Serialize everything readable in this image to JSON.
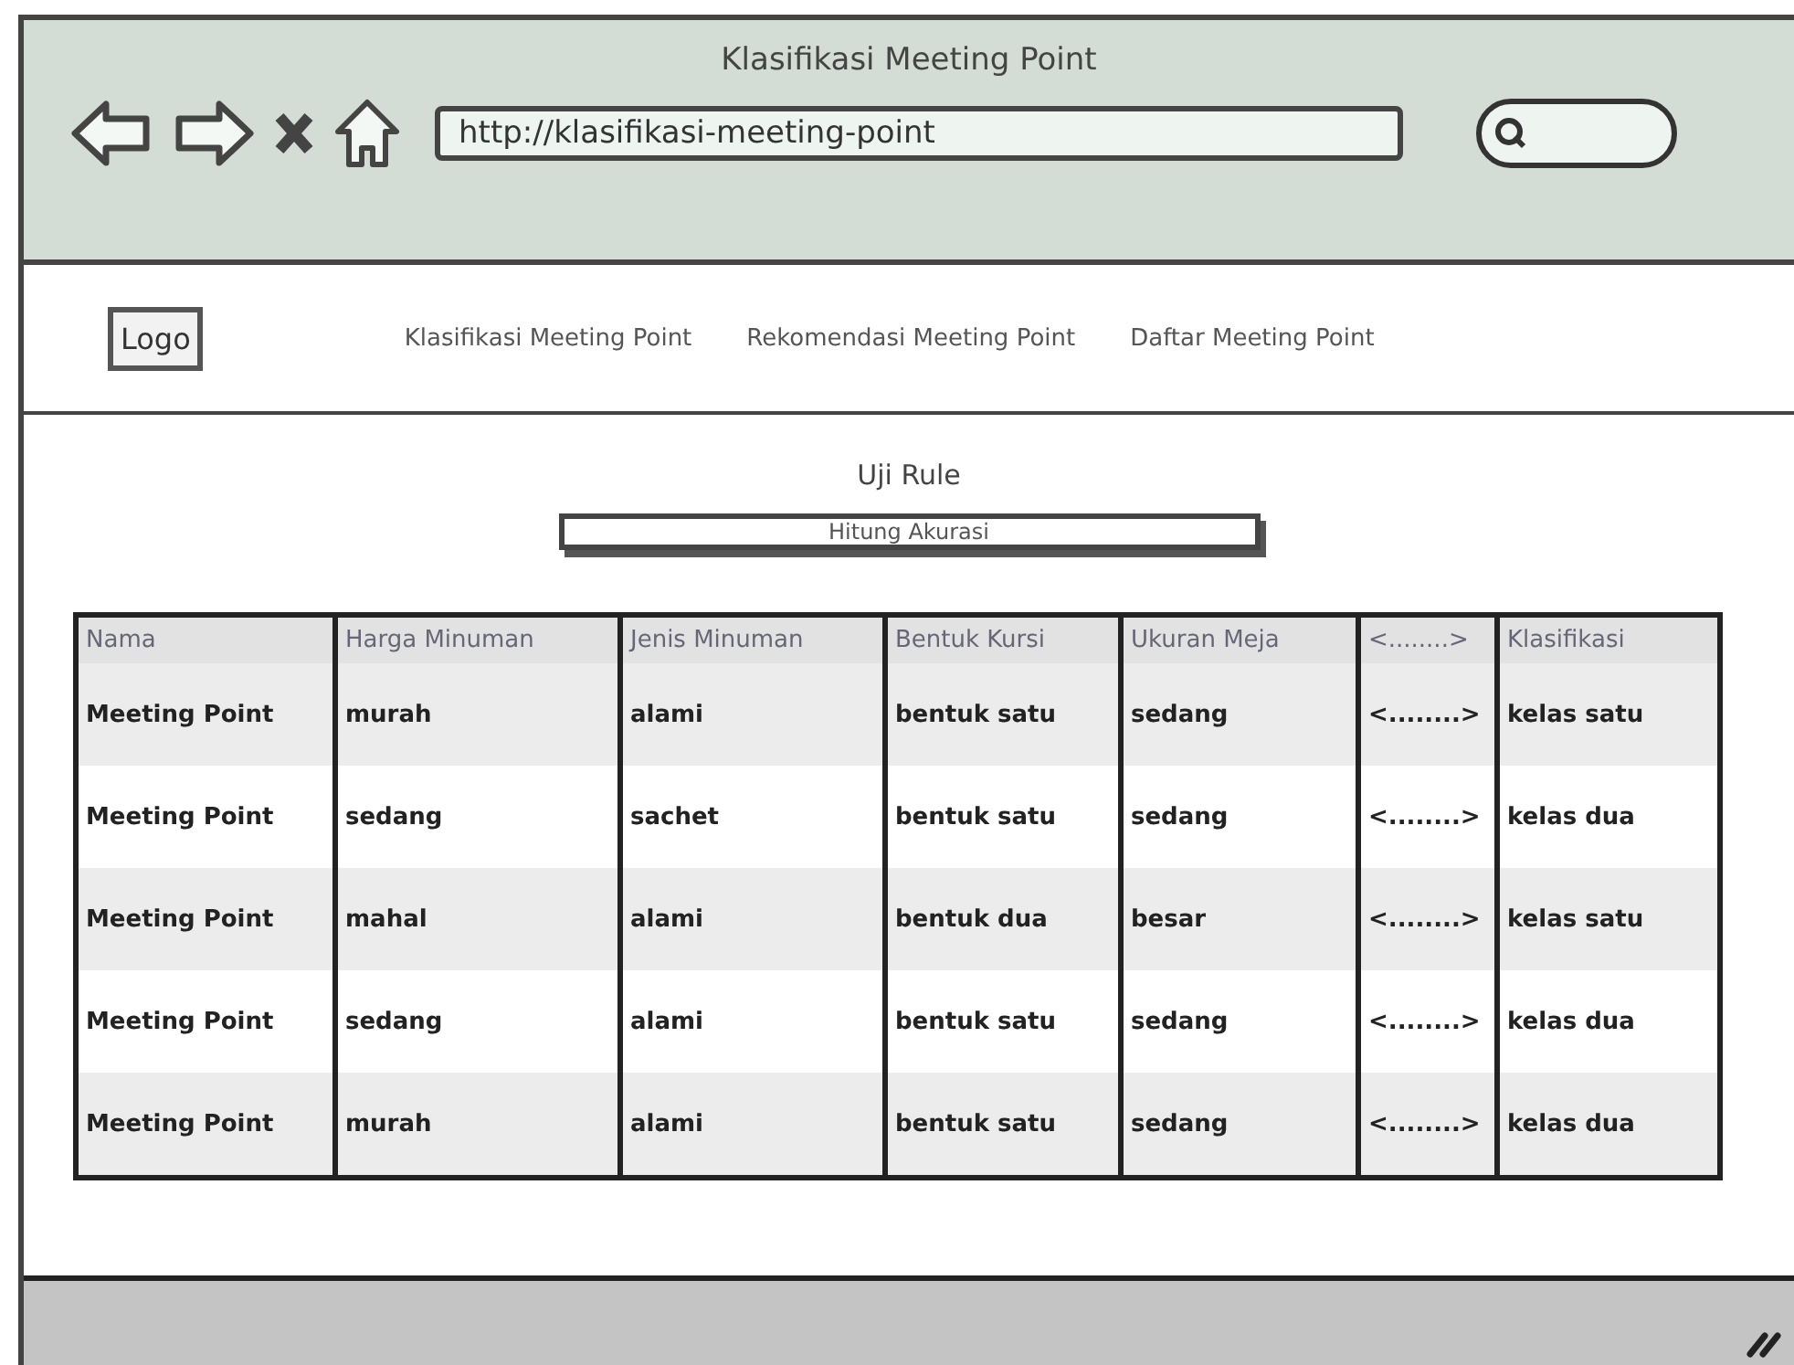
{
  "window": {
    "title": "Klasifikasi Meeting Point",
    "url": "http://klasifikasi-meeting-point"
  },
  "header": {
    "logo": "Logo",
    "nav": [
      {
        "label": "Klasifikasi Meeting Point"
      },
      {
        "label": "Rekomendasi Meeting Point"
      },
      {
        "label": "Daftar Meeting Point"
      }
    ]
  },
  "content": {
    "title": "Uji Rule",
    "button": "Hitung Akurasi"
  },
  "table": {
    "columns": [
      "Nama",
      "Harga Minuman",
      "Jenis Minuman",
      "Bentuk Kursi",
      "Ukuran Meja",
      "<........>",
      "Klasifikasi"
    ],
    "rows": [
      [
        "Meeting Point",
        "murah",
        "alami",
        "bentuk satu",
        "sedang",
        "<........>",
        "kelas satu"
      ],
      [
        "Meeting Point",
        "sedang",
        "sachet",
        "bentuk satu",
        "sedang",
        "<........>",
        "kelas dua"
      ],
      [
        "Meeting Point",
        "mahal",
        "alami",
        "bentuk dua",
        "besar",
        "<........>",
        "kelas satu"
      ],
      [
        "Meeting Point",
        "sedang",
        "alami",
        "bentuk satu",
        "sedang",
        "<........>",
        "kelas dua"
      ],
      [
        "Meeting Point",
        "murah",
        "alami",
        "bentuk satu",
        "sedang",
        "<........>",
        "kelas dua"
      ]
    ]
  }
}
